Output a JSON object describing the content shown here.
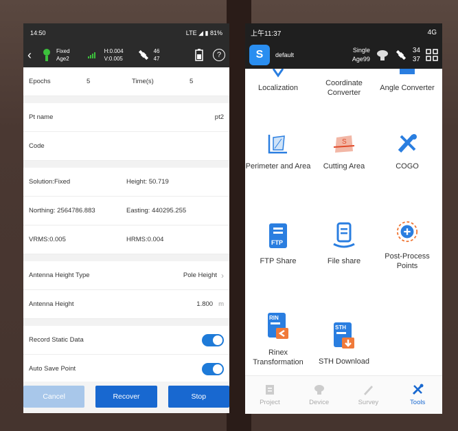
{
  "left": {
    "status": {
      "time": "14:50",
      "network": "LTE ◢ ▮ 81%"
    },
    "header": {
      "fix": "Fixed",
      "age": "Age2",
      "h": "H:0.004",
      "v": "V:0.005",
      "sats_top": "46",
      "sats_bottom": "47",
      "help": "?"
    },
    "epochs_label": "Epochs",
    "epochs_value": "5",
    "time_label": "Time(s)",
    "time_value": "5",
    "pt_name_label": "Pt name",
    "pt_name_value": "pt2",
    "code_label": "Code",
    "solution": "Solution:Fixed",
    "height": "Height: 50.719",
    "northing": "Northing: 2564786.883",
    "easting": "Easting: 440295.255",
    "vrms": "VRMS:0.005",
    "hrms": "HRMS:0.004",
    "antenna_type_label": "Antenna Height Type",
    "antenna_type_value": "Pole Height",
    "antenna_height_label": "Antenna Height",
    "antenna_height_value": "1.800",
    "antenna_height_unit": "m",
    "record_static_label": "Record Static Data",
    "auto_save_label": "Auto Save Point",
    "buttons": {
      "cancel": "Cancel",
      "recover": "Recover",
      "stop": "Stop"
    }
  },
  "right": {
    "status": {
      "time": "上午11:37",
      "network": "4G"
    },
    "header": {
      "project": "default",
      "mode": "Single",
      "age": "Age99",
      "sats_top": "34",
      "sats_bottom": "37"
    },
    "tools": [
      {
        "label": "Localization"
      },
      {
        "label": "Coordinate Converter"
      },
      {
        "label": "Angle Converter"
      },
      {
        "label": "Perimeter and Area"
      },
      {
        "label": "Cutting Area"
      },
      {
        "label": "COGO"
      },
      {
        "label": "FTP Share"
      },
      {
        "label": "File share"
      },
      {
        "label": "Post-Process Points"
      },
      {
        "label": "Rinex Transformation"
      },
      {
        "label": "STH Download"
      }
    ],
    "tabs": [
      {
        "label": "Project"
      },
      {
        "label": "Device"
      },
      {
        "label": "Survey"
      },
      {
        "label": "Tools"
      }
    ],
    "icon_texts": {
      "ftp": "FTP",
      "rin": "RIN",
      "sth": "STH",
      "cut": "S"
    }
  },
  "colors": {
    "accent": "#1868d0",
    "header_bg": "#2b2b2b",
    "toggle_on": "#1e7ad8"
  }
}
